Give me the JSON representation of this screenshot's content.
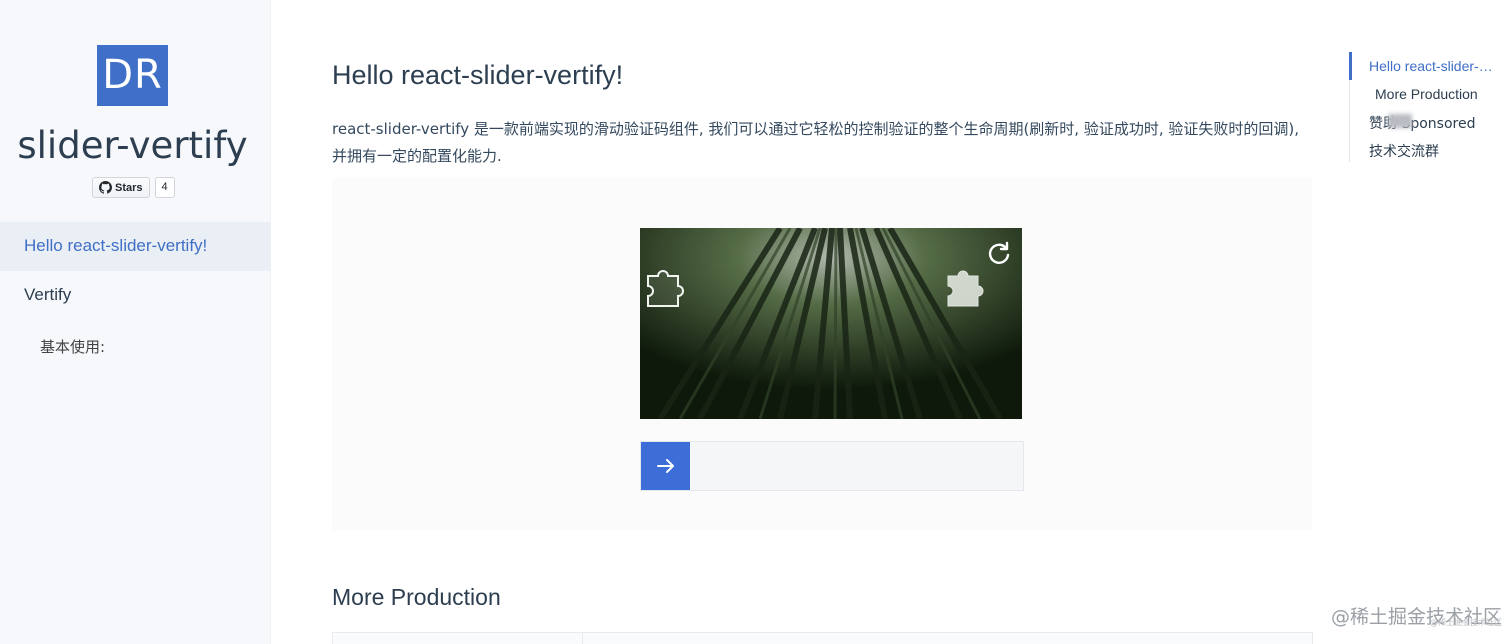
{
  "sidebar": {
    "logo_text": "DR",
    "title": "slider-vertify",
    "github": {
      "stars_label": "Stars",
      "stars_count": "4"
    },
    "nav": [
      {
        "label": "Hello react-slider-vertify!",
        "active": true
      },
      {
        "label": "Vertify"
      },
      {
        "label": "基本使用:"
      }
    ]
  },
  "main": {
    "title": "Hello react-slider-vertify!",
    "intro": "react-slider-vertify 是一款前端实现的滑动验证码组件, 我们可以通过它轻松的控制验证的整个生命周期(刷新时, 验证成功时, 验证失败时的回调), 并拥有一定的配置化能力.",
    "demo": {
      "refresh_icon": "refresh-icon",
      "handle_icon": "arrow-right-icon"
    },
    "section2_title": "More Production"
  },
  "toc": {
    "items": [
      "Hello react-slider-vertify!",
      "More Production",
      "赞助 Sponsored",
      "技术交流群"
    ]
  },
  "watermark": {
    "text": "@稀土掘金技术社区",
    "small": "@稀土掘金技术社区"
  },
  "colors": {
    "accent": "#3f6fc6",
    "handle": "#3d6ed8"
  }
}
